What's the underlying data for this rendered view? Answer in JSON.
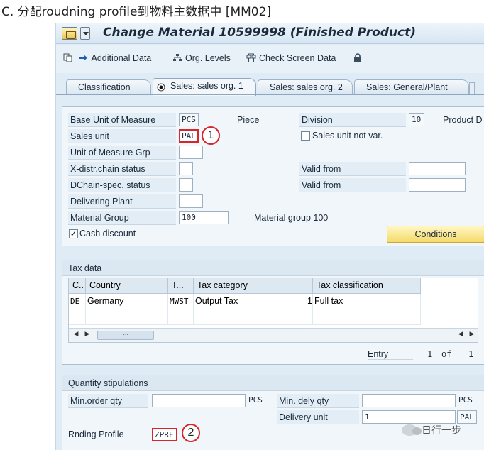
{
  "caption": "C. 分配roudning profile到物料主数据中 [MM02]",
  "window": {
    "title": "Change Material 10599998 (Finished Product)"
  },
  "toolbar": {
    "additional_data": "Additional Data",
    "org_levels": "Org. Levels",
    "check_screen_data": "Check Screen Data"
  },
  "tabs": [
    {
      "label": "Classification",
      "active": false
    },
    {
      "label": "Sales: sales org. 1",
      "active": true
    },
    {
      "label": "Sales: sales org. 2",
      "active": false
    },
    {
      "label": "Sales: General/Plant",
      "active": false
    }
  ],
  "general": {
    "base_uom_label": "Base Unit of Measure",
    "base_uom_value": "PCS",
    "base_uom_text": "Piece",
    "division_label": "Division",
    "division_value": "10",
    "product_label": "Product D",
    "sales_unit_label": "Sales unit",
    "sales_unit_value": "PAL",
    "sales_unit_not_var_label": "Sales unit not var.",
    "uom_group_label": "Unit of Measure Grp",
    "xdistr_label": "X-distr.chain status",
    "valid_from_label_1": "Valid from",
    "dchain_label": "DChain-spec. status",
    "valid_from_label_2": "Valid from",
    "delivering_plant_label": "Delivering Plant",
    "material_group_label": "Material Group",
    "material_group_value": "100",
    "material_group_text": "Material group 100",
    "cash_discount_label": "Cash discount",
    "cash_discount_checked": true,
    "conditions_button": "Conditions",
    "badge_1": "1"
  },
  "tax": {
    "title": "Tax data",
    "columns": [
      "C..",
      "Country",
      "T...",
      "Tax category",
      "Tax classification"
    ],
    "rows": [
      {
        "c": "DE",
        "country": "Germany",
        "t": "MWST",
        "category": "Output Tax",
        "class_code": "1",
        "class_text": "Full tax"
      }
    ],
    "entry_label": "Entry",
    "entry_current": "1",
    "entry_of": "of",
    "entry_total": "1"
  },
  "quantity": {
    "title": "Quantity stipulations",
    "min_order_label": "Min.order qty",
    "min_order_unit": "PCS",
    "min_dely_label": "Min. dely qty",
    "min_dely_unit": "PCS",
    "delivery_unit_label": "Delivery unit",
    "delivery_unit_value": "1",
    "delivery_unit_unit": "PAL",
    "rnding_profile_label": "Rnding Profile",
    "rnding_profile_value": "ZPRF",
    "badge_2": "2"
  },
  "watermark": "日行一步",
  "colors": {
    "highlight": "#d6262d",
    "sap_background": "#dfebf5",
    "conditions_button": "#f5db6a"
  }
}
